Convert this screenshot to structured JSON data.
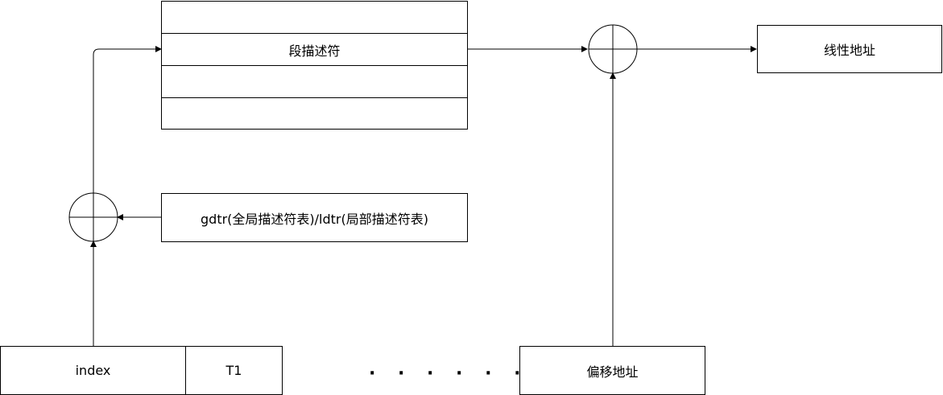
{
  "descriptor_table": {
    "rows": [
      "",
      "段描述符",
      "",
      ""
    ]
  },
  "linear_address": "线性地址",
  "table_register": "gdtr(全局描述符表)/ldtr(局部描述符表)",
  "selector": {
    "index": "index",
    "ti": "T1"
  },
  "offset": "偏移地址",
  "ellipsis": "· · · · · ·",
  "colors": {
    "stroke": "#000000",
    "background": "#ffffff"
  }
}
